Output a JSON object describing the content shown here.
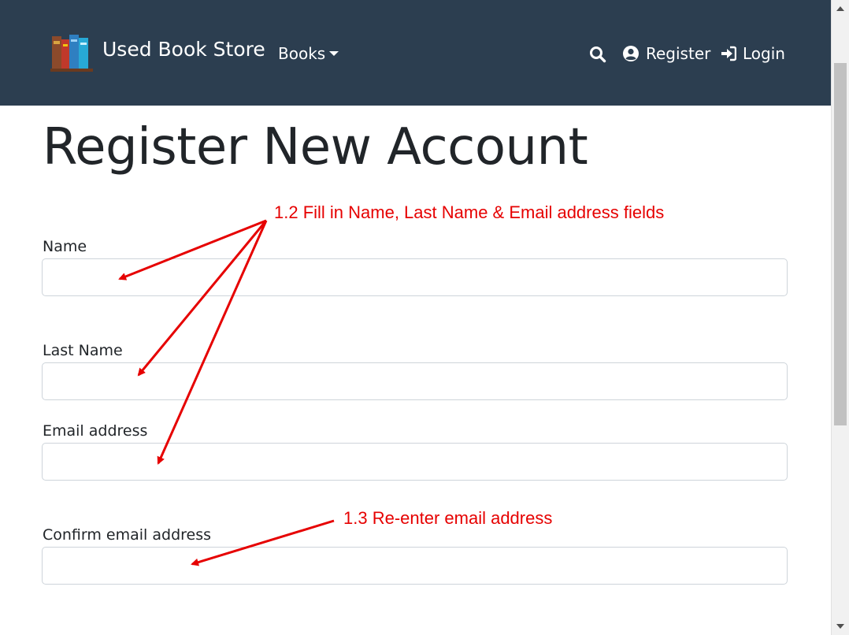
{
  "navbar": {
    "brand": "Used Book Store",
    "books_menu": "Books",
    "register": "Register",
    "login": "Login",
    "icons": {
      "logo": "books-logo-icon",
      "search": "search-icon",
      "register": "user-circle-icon",
      "login": "sign-in-icon"
    },
    "colors": {
      "background": "#2c3e50",
      "text": "#ffffff"
    }
  },
  "page": {
    "title": "Register New Account"
  },
  "form": {
    "name_label": "Name",
    "last_name_label": "Last Name",
    "email_label": "Email address",
    "confirm_email_label": "Confirm email address",
    "name_value": "",
    "last_name_value": "",
    "email_value": "",
    "confirm_email_value": ""
  },
  "annotations": {
    "step_1_2": "1.2  Fill in Name, Last Name & Email address fields",
    "step_1_3": "1.3  Re-enter email address",
    "color": "#e60000"
  }
}
